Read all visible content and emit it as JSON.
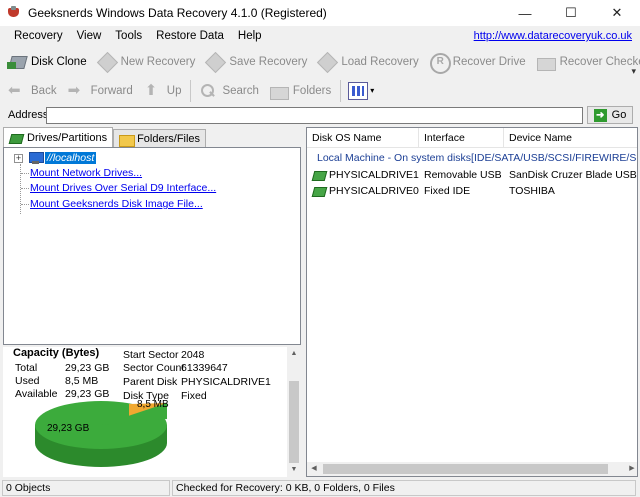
{
  "window": {
    "title": "Geeksnerds Windows Data Recovery 4.1.0 (Registered)",
    "minimize": "—",
    "maximize": "☐",
    "close": "✕"
  },
  "menu": {
    "items": [
      "Recovery",
      "View",
      "Tools",
      "Restore Data",
      "Help"
    ],
    "link": "http://www.datarecoveryuk.co.uk"
  },
  "toolbar1": {
    "disk_clone": "Disk Clone",
    "new_recovery": "New Recovery",
    "save_recovery": "Save Recovery",
    "load_recovery": "Load Recovery",
    "recover_drive": "Recover Drive",
    "recover_checked": "Recover Checked"
  },
  "toolbar2": {
    "back": "Back",
    "forward": "Forward",
    "up": "Up",
    "search": "Search",
    "folders": "Folders"
  },
  "address": {
    "label": "Address",
    "value": "",
    "go": "Go"
  },
  "left": {
    "tabs": [
      "Drives/Partitions",
      "Folders/Files"
    ],
    "tree": {
      "root": "//localhost",
      "items": [
        "Mount Network Drives...",
        "Mount Drives Over Serial D9 Interface...",
        "Mount Geeksnerds Disk Image File..."
      ]
    },
    "capacity": {
      "title": "Capacity (Bytes)",
      "total_label": "Total",
      "total_value": "29,23 GB",
      "used_label": "Used",
      "used_value": "8,5 MB",
      "available_label": "Available",
      "available_value": "29,23 GB",
      "start_sector_label": "Start Sector",
      "start_sector_value": "2048",
      "sector_count_label": "Sector Count",
      "sector_count_value": "61339647",
      "parent_disk_label": "Parent Disk",
      "parent_disk_value": "PHYSICALDRIVE1",
      "disk_type_label": "Disk Type",
      "disk_type_value": "Fixed",
      "pie_used_label": "8,5 MB",
      "pie_available_label": "29,23 GB",
      "pie_colors": {
        "available": "#3cab3c",
        "used": "#f0a830"
      }
    }
  },
  "right": {
    "columns": [
      "Disk OS Name",
      "Interface",
      "Device Name"
    ],
    "group": "Local Machine - On system disks[IDE/SATA/USB/SCSI/FIREWIRE/SERIAL",
    "rows": [
      {
        "name": "PHYSICALDRIVE1",
        "interface": "Removable USB",
        "device": "SanDisk Cruzer Blade USB D..."
      },
      {
        "name": "PHYSICALDRIVE0",
        "interface": "Fixed IDE",
        "device": "TOSHIBA"
      }
    ]
  },
  "status": {
    "objects": "0 Objects",
    "checked": "Checked for Recovery: 0 KB, 0 Folders, 0 Files"
  }
}
